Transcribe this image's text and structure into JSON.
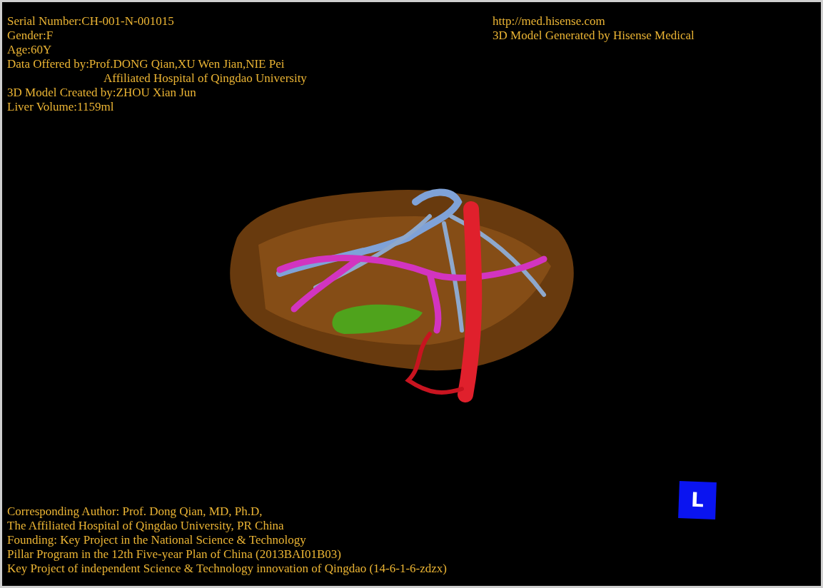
{
  "info_lines": [
    {
      "text": "Serial Number:CH-001-N-001015",
      "kind": "plain"
    },
    {
      "text": "Gender:F",
      "kind": "plain"
    },
    {
      "text": "Age:60Y",
      "kind": "plain"
    },
    {
      "text": "Data Offered by:Prof.DONG Qian,XU Wen Jian,NIE Pei",
      "kind": "plain"
    },
    {
      "text": "Affiliated Hospital of Qingdao University",
      "kind": "indented"
    },
    {
      "text": "3D Model Created by:ZHOU Xian Jun",
      "kind": "plain"
    },
    {
      "text": "Liver Volume:1159ml",
      "kind": "plain"
    }
  ],
  "credit_lines": [
    {
      "text": "http://med.hisense.com"
    },
    {
      "text": "3D Model Generated by Hisense Medical"
    }
  ],
  "footer_lines": [
    {
      "text": "Corresponding Author: Prof. Dong Qian, MD, Ph.D,"
    },
    {
      "text": "The Affiliated Hospital of Qingdao University, PR China"
    },
    {
      "text": "Founding: Key Project in the National Science & Technology"
    },
    {
      "text": "Pillar Program in the 12th Five-year Plan of China (2013BAI01B03)"
    },
    {
      "text": "Key Project of independent Science & Technology innovation of Qingdao (14-6-1-6-zdzx)"
    }
  ],
  "orientation_marker": {
    "label": "L"
  }
}
